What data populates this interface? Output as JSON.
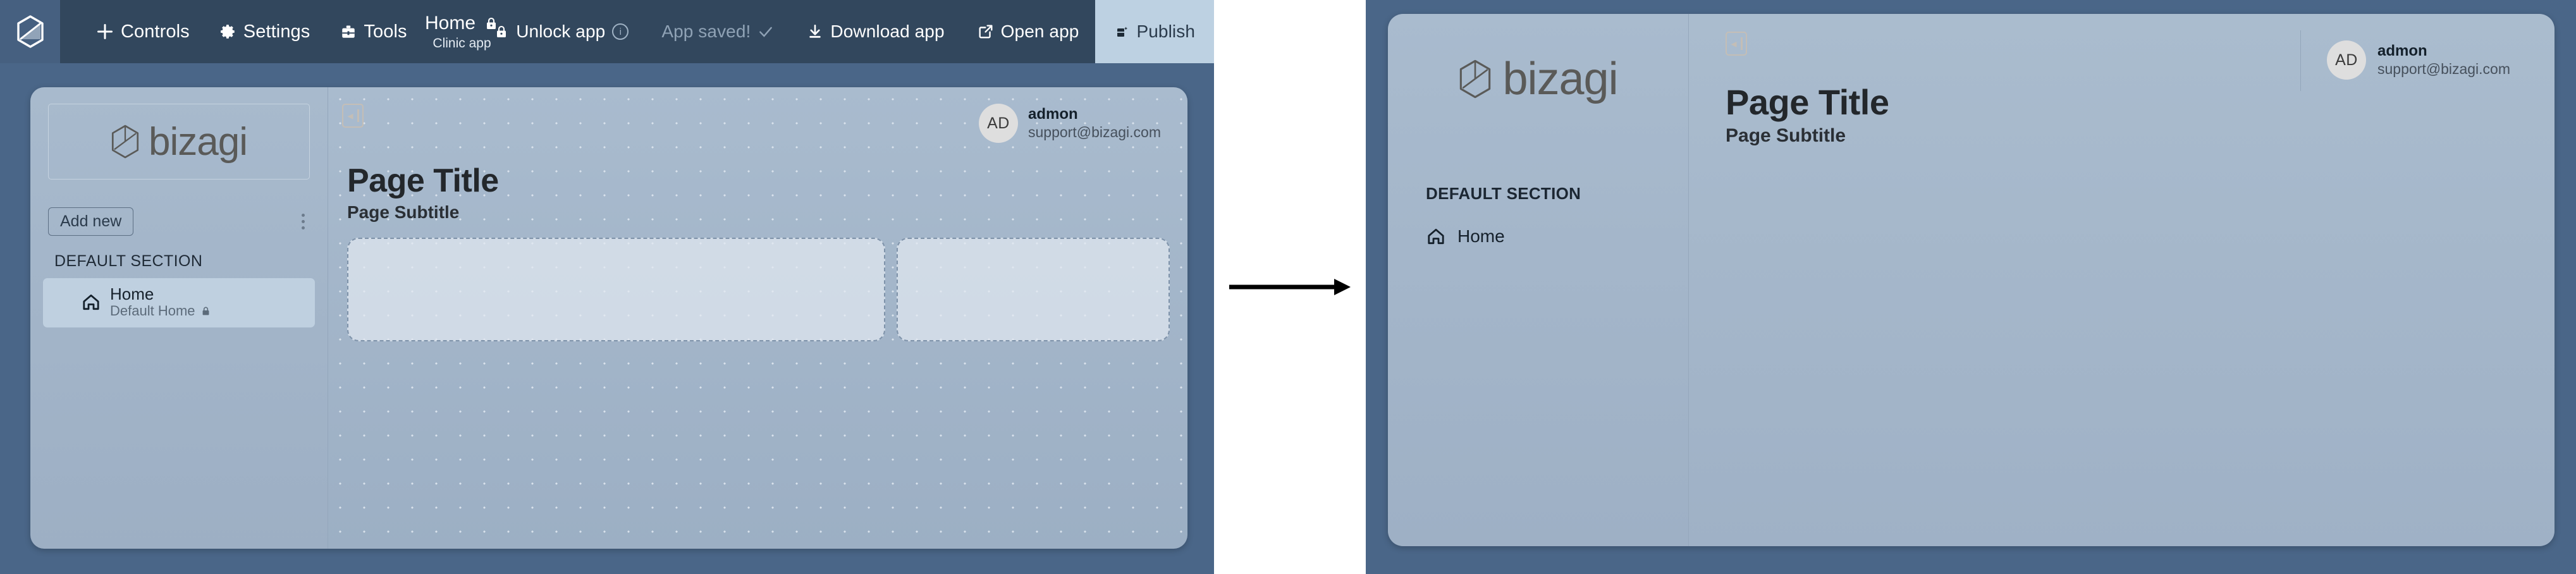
{
  "toolbar": {
    "logo_icon": "bizagi-hexagon-logo",
    "items": [
      {
        "label": "Controls",
        "icon": "plus-icon"
      },
      {
        "label": "Settings",
        "icon": "gear-icon"
      },
      {
        "label": "Tools",
        "icon": "toolbox-icon"
      }
    ],
    "app_name": "Home",
    "app_name_icon": "lock-icon",
    "app_subtitle": "Clinic app",
    "right_items": [
      {
        "label": "Unlock app",
        "icon": "lock-icon",
        "suffix_icon": "info-icon",
        "muted": false
      },
      {
        "label": "App saved!",
        "icon": "",
        "suffix_icon": "check-icon",
        "muted": true
      },
      {
        "label": "Download app",
        "icon": "download-icon",
        "suffix_icon": "",
        "muted": false
      },
      {
        "label": "Open app",
        "icon": "external-link-icon",
        "suffix_icon": "",
        "muted": false
      }
    ],
    "publish_label": "Publish",
    "publish_icon": "publish-icon"
  },
  "designer_preview": {
    "brand_word": "bizagi",
    "brand_icon": "bizagi-hexagon-logo",
    "add_new_label": "Add new",
    "kebab_icon": "more-vertical-icon",
    "section_label": "DEFAULT SECTION",
    "nav_items": [
      {
        "icon": "home-icon",
        "title": "Home",
        "subtitle": "Default Home",
        "subtitle_icon": "lock-icon",
        "selected": true
      }
    ],
    "collapse_icon": "collapse-panel-icon",
    "user": {
      "initials": "AD",
      "name": "admon",
      "email": "support@bizagi.com"
    },
    "page_title": "Page Title",
    "page_subtitle": "Page Subtitle",
    "cards": [
      {
        "name": "placeholder-card-wide"
      },
      {
        "name": "placeholder-card-narrow"
      }
    ]
  },
  "arrow": {
    "icon": "arrow-right-icon"
  },
  "runtime_preview": {
    "brand_word": "bizagi",
    "brand_icon": "bizagi-hexagon-logo",
    "section_label": "DEFAULT SECTION",
    "nav_items": [
      {
        "icon": "home-icon",
        "title": "Home"
      }
    ],
    "collapse_icon": "collapse-panel-icon",
    "user": {
      "initials": "AD",
      "name": "admon",
      "email": "support@bizagi.com"
    },
    "page_title": "Page Title",
    "page_subtitle": "Page Subtitle"
  },
  "colors": {
    "toolbar_bg": "#32475d",
    "toolbar_logo_bg": "#466080",
    "canvas_bg": "#4a6688",
    "preview_sidebar_bg": "#a8bacd",
    "preview_content_bg": "#a9bbce",
    "publish_bg": "#bdd1e2",
    "nav_selected_bg": "#bfd0e0",
    "avatar_bg": "#dedede",
    "brand_text": "#5a5a58"
  }
}
